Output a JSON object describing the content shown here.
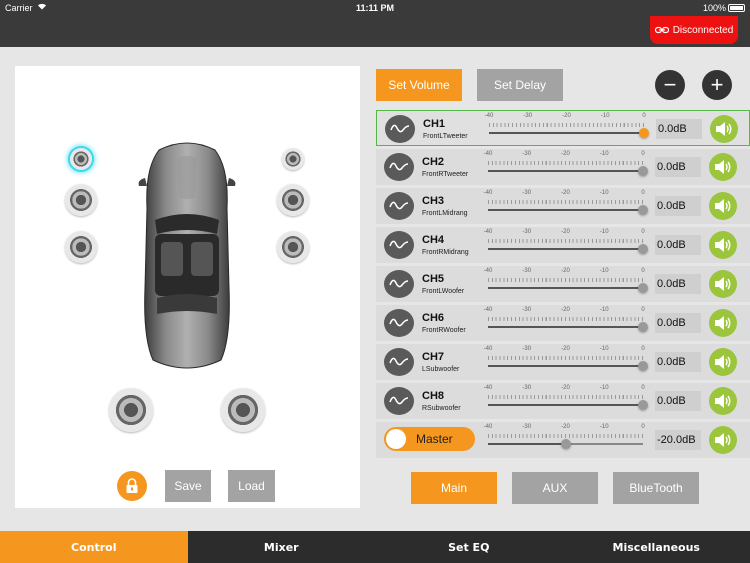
{
  "status_bar": {
    "carrier": "Carrier",
    "time": "11:11 PM",
    "battery": "100%"
  },
  "connection": {
    "label": "Disconnected",
    "color": "#ee1111"
  },
  "toolbar": {
    "set_volume": "Set Volume",
    "set_delay": "Set Delay",
    "minus": "−",
    "plus": "+"
  },
  "left_panel": {
    "save": "Save",
    "load": "Load"
  },
  "slider_scale": [
    "-40",
    "-30",
    "-20",
    "-10",
    "0"
  ],
  "channels": [
    {
      "name": "CH1",
      "sub": "FrontLTweeter",
      "value": "0.0dB",
      "level": 0,
      "selected": true
    },
    {
      "name": "CH2",
      "sub": "FrontRTweeter",
      "value": "0.0dB",
      "level": 0,
      "selected": false
    },
    {
      "name": "CH3",
      "sub": "FrontLMidrang",
      "value": "0.0dB",
      "level": 0,
      "selected": false
    },
    {
      "name": "CH4",
      "sub": "FrontRMidrang",
      "value": "0.0dB",
      "level": 0,
      "selected": false
    },
    {
      "name": "CH5",
      "sub": "FrontLWoofer",
      "value": "0.0dB",
      "level": 0,
      "selected": false
    },
    {
      "name": "CH6",
      "sub": "FrontRWoofer",
      "value": "0.0dB",
      "level": 0,
      "selected": false
    },
    {
      "name": "CH7",
      "sub": "LSubwoofer",
      "value": "0.0dB",
      "level": 0,
      "selected": false
    },
    {
      "name": "CH8",
      "sub": "RSubwoofer",
      "value": "0.0dB",
      "level": 0,
      "selected": false
    }
  ],
  "master": {
    "label": "Master",
    "value": "-20.0dB",
    "level": -20
  },
  "sources": {
    "main": "Main",
    "aux": "AUX",
    "bluetooth": "BlueTooth",
    "selected": "Main"
  },
  "bottom_nav": [
    {
      "label": "Control",
      "active": true
    },
    {
      "label": "Mixer",
      "active": false
    },
    {
      "label": "Set EQ",
      "active": false
    },
    {
      "label": "Miscellaneous",
      "active": false
    }
  ],
  "colors": {
    "accent": "#f5961e",
    "speaker_on": "#9bc53d",
    "selected_row": "#52b84a",
    "active_speaker_glow": "#3ad9ee"
  }
}
